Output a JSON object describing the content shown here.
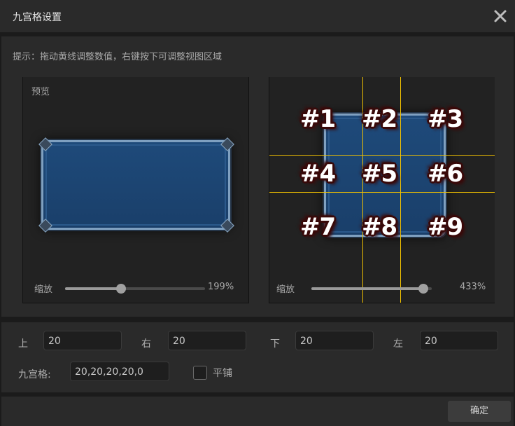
{
  "window": {
    "title": "九宫格设置"
  },
  "hint": "提示：拖动黄线调整数值，右键按下可调整视图区域",
  "left_preview": {
    "label": "预览",
    "zoom_label": "缩放",
    "zoom_value": "199%",
    "zoom_fraction": 0.4
  },
  "right_preview": {
    "zoom_label": "缩放",
    "zoom_value": "433%",
    "zoom_fraction": 0.93,
    "tags": [
      "#1",
      "#2",
      "#3",
      "#4",
      "#5",
      "#6",
      "#7",
      "#8",
      "#9"
    ]
  },
  "fields": {
    "top": {
      "label": "上",
      "value": "20"
    },
    "right": {
      "label": "右",
      "value": "20"
    },
    "bottom": {
      "label": "下",
      "value": "20"
    },
    "left": {
      "label": "左",
      "value": "20"
    }
  },
  "nine_grid": {
    "label": "九宫格:",
    "value": "20,20,20,20,0"
  },
  "tile": {
    "label": "平铺",
    "checked": false
  },
  "confirm_label": "确定",
  "colors": {
    "guide_line": "#f0c000",
    "frame_fill": "#1e4a7a",
    "background": "#2a2a2a"
  }
}
